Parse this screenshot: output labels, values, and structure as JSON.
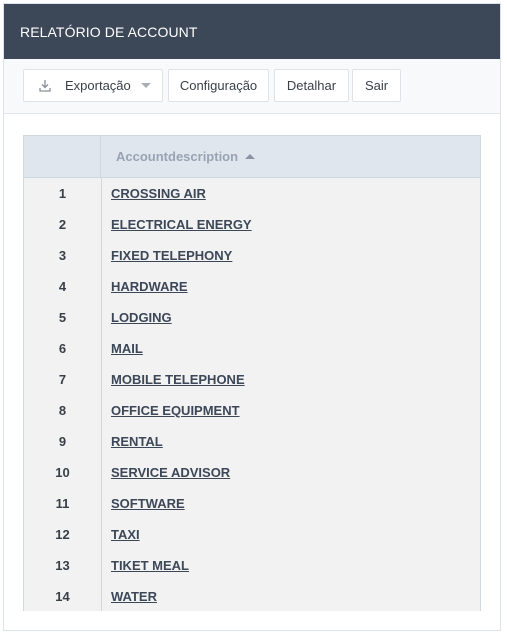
{
  "header": {
    "title": "RELATÓRIO DE ACCOUNT"
  },
  "toolbar": {
    "export_label": "Exportação",
    "export_icon": "download-icon",
    "config_label": "Configuração",
    "detail_label": "Detalhar",
    "exit_label": "Sair"
  },
  "table": {
    "columns": [
      "",
      "Accountdescription"
    ],
    "sort": "ascending",
    "rows": [
      {
        "num": "1",
        "desc": "CROSSING AIR"
      },
      {
        "num": "2",
        "desc": "ELECTRICAL ENERGY"
      },
      {
        "num": "3",
        "desc": "FIXED TELEPHONY"
      },
      {
        "num": "4",
        "desc": "HARDWARE"
      },
      {
        "num": "5",
        "desc": "LODGING"
      },
      {
        "num": "6",
        "desc": "MAIL"
      },
      {
        "num": "7",
        "desc": "MOBILE TELEPHONE"
      },
      {
        "num": "8",
        "desc": "OFFICE EQUIPMENT"
      },
      {
        "num": "9",
        "desc": "RENTAL"
      },
      {
        "num": "10",
        "desc": "SERVICE ADVISOR"
      },
      {
        "num": "11",
        "desc": "SOFTWARE"
      },
      {
        "num": "12",
        "desc": "TAXI"
      },
      {
        "num": "13",
        "desc": "TIKET MEAL"
      },
      {
        "num": "14",
        "desc": "WATER"
      }
    ]
  }
}
